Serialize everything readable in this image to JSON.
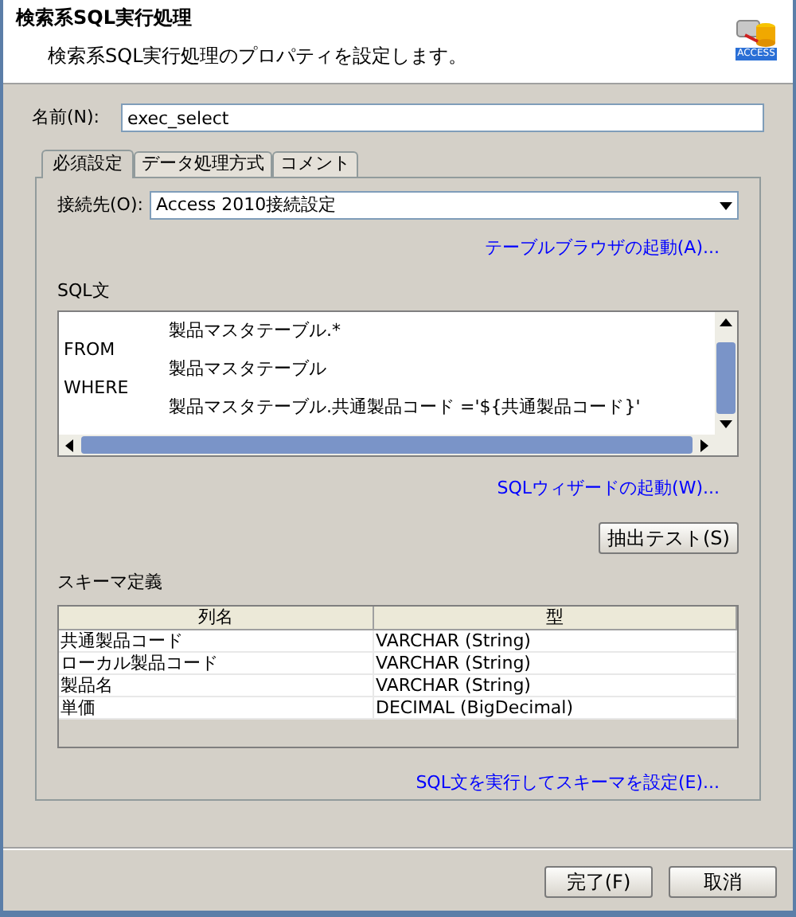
{
  "header": {
    "title": "検索系SQL実行処理",
    "description": "検索系SQL実行処理のプロパティを設定します。",
    "logo_text": "ACCESS"
  },
  "name_field": {
    "label": "名前(N):",
    "value": "exec_select"
  },
  "tabs": [
    {
      "label": "必須設定",
      "selected": true
    },
    {
      "label": "データ処理方式",
      "selected": false
    },
    {
      "label": "コメント",
      "selected": false
    }
  ],
  "connection": {
    "label": "接続先(O):",
    "value": "Access 2010接続設定"
  },
  "table_browser_link": "テーブルブラウザの起動(A)...",
  "sql": {
    "label": "SQL文",
    "lines": [
      {
        "text": "製品マスタテーブル.*"
      },
      {
        "keyword": "FROM"
      },
      {
        "text": "製品マスタテーブル"
      },
      {
        "keyword": "WHERE"
      },
      {
        "text": "製品マスタテーブル.共通製品コード ='${共通製品コード}'"
      }
    ]
  },
  "sql_wizard_link": "SQLウィザードの起動(W)...",
  "extract_test_button": "抽出テスト(S)",
  "schema": {
    "label": "スキーマ定義",
    "columns": [
      "列名",
      "型"
    ],
    "rows": [
      [
        "共通製品コード",
        "VARCHAR (String)"
      ],
      [
        "ローカル製品コード",
        "VARCHAR (String)"
      ],
      [
        "製品名",
        "VARCHAR (String)"
      ],
      [
        "単価",
        "DECIMAL (BigDecimal)"
      ]
    ]
  },
  "set_schema_link": "SQL文を実行してスキーマを設定(E)...",
  "buttons": [
    "完了(F)",
    "取消"
  ]
}
